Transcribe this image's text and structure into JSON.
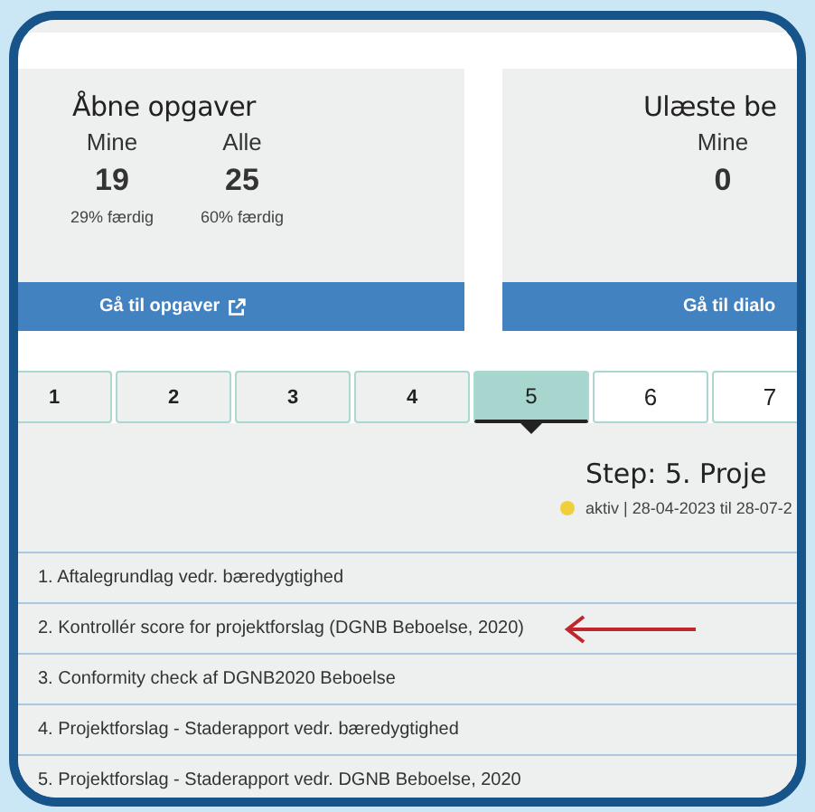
{
  "cards": [
    {
      "title": "Åbne opgaver",
      "stats": [
        {
          "label": "Mine",
          "value": "19",
          "note": "29% færdig"
        },
        {
          "label": "Alle",
          "value": "25",
          "note": "60% færdig"
        }
      ],
      "button": "Gå til opgaver",
      "external": true
    },
    {
      "title": "Ulæste be",
      "stats": [
        {
          "label": "Mine",
          "value": "0"
        }
      ],
      "button": "Gå til dialo",
      "external": false
    }
  ],
  "tabs": [
    {
      "label": "1",
      "selected": false
    },
    {
      "label": "2",
      "selected": false
    },
    {
      "label": "3",
      "selected": false
    },
    {
      "label": "4",
      "selected": false
    },
    {
      "label": "5",
      "selected": true
    },
    {
      "label": "6",
      "selected": false
    },
    {
      "label": "7",
      "selected": false
    }
  ],
  "step": {
    "title": "Step: 5. Proje",
    "status": "aktiv | 28-04-2023 til 28-07-2"
  },
  "tasks": [
    {
      "text": "1. Aftalegrundlag vedr. bæredygtighed",
      "arrow": false
    },
    {
      "text": "2. Kontrollér score for projektforslag (DGNB Beboelse, 2020)",
      "arrow": true
    },
    {
      "text": "3. Conformity check af DGNB2020 Beboelse",
      "arrow": false
    },
    {
      "text": "4. Projektforslag - Staderapport vedr. bæredygtighed",
      "arrow": false
    },
    {
      "text": "5. Projektforslag - Staderapport vedr. DGNB Beboelse, 2020",
      "arrow": false
    }
  ]
}
